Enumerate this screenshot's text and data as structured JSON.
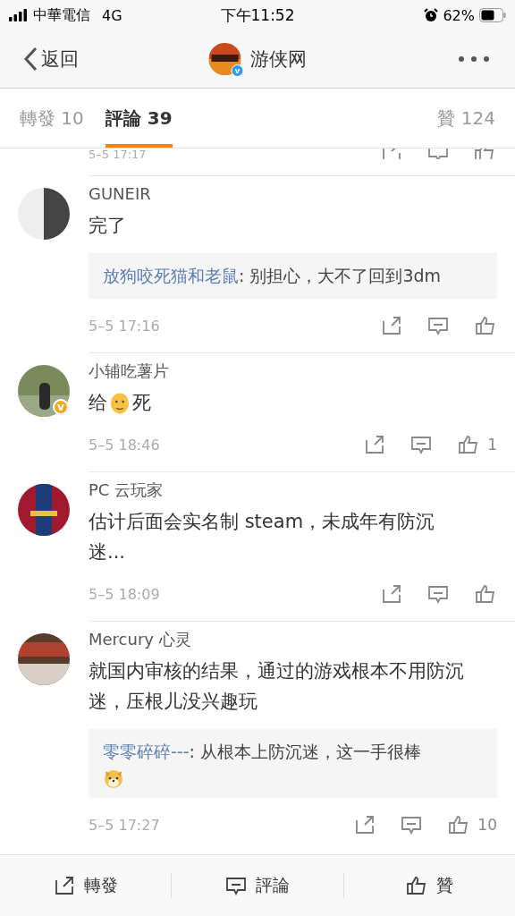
{
  "status_bar": {
    "carrier": "中華電信",
    "network": "4G",
    "time": "下午11:52",
    "battery_text": "62%"
  },
  "nav": {
    "back": "返回",
    "title": "游侠网",
    "badge": {
      "text": "v",
      "color": "#2d9bf0"
    }
  },
  "tabs": [
    {
      "label": "轉發 10",
      "selected": false
    },
    {
      "label": "評論 39",
      "selected": true
    },
    {
      "label": "贊 124",
      "selected": false
    }
  ],
  "partial_comment": {
    "time": "5–5 17:17"
  },
  "comments": [
    {
      "name": "GUNEIR",
      "body": [
        {
          "kind": "text",
          "text": "完了"
        }
      ],
      "reply": {
        "author": "放狗咬死猫和老鼠",
        "text": ": 别担心，大不了回到3dm",
        "emoji": false
      },
      "time": "5–5 17:16"
    },
    {
      "name": "小辅吃薯片",
      "badge": {
        "text": "v",
        "color": "#f5a623"
      },
      "body": [
        {
          "kind": "text",
          "text": "给"
        },
        {
          "kind": "emoji"
        },
        {
          "kind": "text",
          "text": "死"
        }
      ],
      "time": "5–5 18:46",
      "likes": "1"
    },
    {
      "name": "PC 云玩家",
      "body": [
        {
          "kind": "text",
          "text": "估计后面会实名制 steam，未成年有防沉迷..."
        }
      ],
      "time": "5–5 18:09"
    },
    {
      "name": "Mercury 心灵",
      "body": [
        {
          "kind": "text",
          "text": "就国内审核的结果，通过的游戏根本不用防沉迷，压根儿没兴趣玩"
        }
      ],
      "reply": {
        "author": "零零碎碎---",
        "text": ": 从根本上防沉迷，这一手很棒",
        "emoji": true
      },
      "time": "5–5 17:27",
      "likes": "10"
    }
  ],
  "bottom_bar": [
    {
      "kind": "share",
      "label": "轉發"
    },
    {
      "kind": "comment",
      "label": "評論"
    },
    {
      "kind": "like",
      "label": "贊"
    }
  ]
}
